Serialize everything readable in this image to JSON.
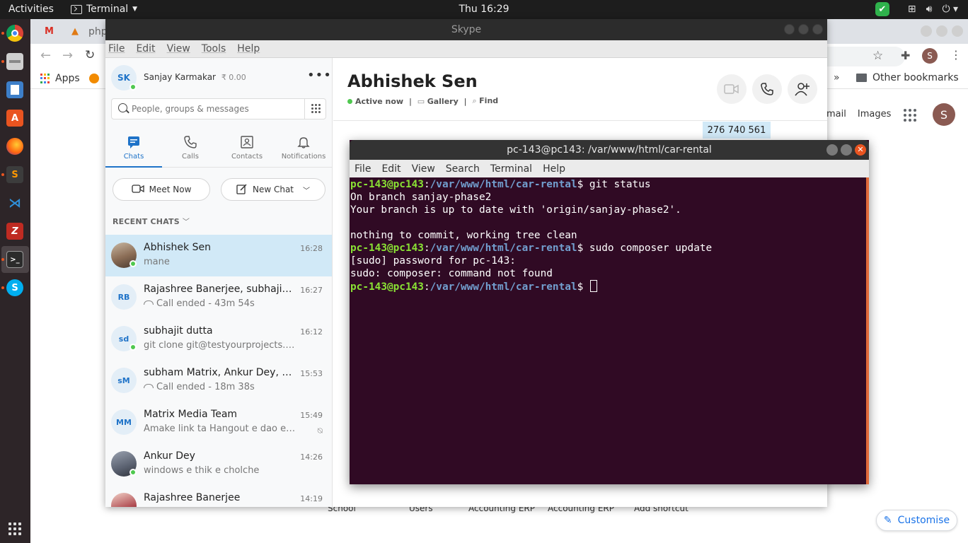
{
  "topbar": {
    "activities": "Activities",
    "app_name": "Terminal",
    "clock": "Thu 16:29"
  },
  "chrome": {
    "tab_partial": "php",
    "apps_label": "Apps",
    "bookmarks_chevron": "»",
    "other_bookmarks": "Other bookmarks",
    "profile_initial": "S",
    "google_links": [
      "mail",
      "Images"
    ],
    "avatar_initial": "S",
    "shortcuts": [
      "School",
      "Users",
      "Accounting ERP",
      "Accounting ERP",
      "Add shortcut"
    ],
    "customise": "Customise"
  },
  "skype": {
    "window_title": "Skype",
    "menu": [
      "File",
      "Edit",
      "View",
      "Tools",
      "Help"
    ],
    "profile": {
      "initials": "SK",
      "name": "Sanjay Karmakar",
      "credit": "₹ 0.00"
    },
    "search_placeholder": "People, groups & messages",
    "nav": [
      "Chats",
      "Calls",
      "Contacts",
      "Notifications"
    ],
    "meet_now": "Meet Now",
    "new_chat": "New Chat",
    "recent_header": "RECENT CHATS",
    "chats": [
      {
        "name": "Abhishek Sen",
        "time": "16:28",
        "message": "mane",
        "initials": ""
      },
      {
        "name": "Rajashree Banerjee, subhajit d...",
        "time": "16:27",
        "message": "Call ended - 43m 54s",
        "initials": "RB"
      },
      {
        "name": "subhajit dutta",
        "time": "16:12",
        "message": "git clone git@testyourprojects.b...",
        "initials": "sd"
      },
      {
        "name": "subham Matrix, Ankur Dey, 2 ...",
        "time": "15:53",
        "message": "Call ended - 18m 38s",
        "initials": "sM"
      },
      {
        "name": "Matrix Media Team",
        "time": "15:49",
        "message": "Amake link ta Hangout e dao ek...",
        "initials": "MM"
      },
      {
        "name": "Ankur Dey",
        "time": "14:26",
        "message": "windows e thik e cholche",
        "initials": ""
      },
      {
        "name": "Rajashree Banerjee",
        "time": "14:19",
        "message": "",
        "initials": ""
      }
    ],
    "conversation": {
      "title": "Abhishek Sen",
      "status": "Active now",
      "gallery": "Gallery",
      "find": "Find",
      "bubble": "276 740 561"
    }
  },
  "terminal": {
    "title": "pc-143@pc143: /var/www/html/car-rental",
    "menu": [
      "File",
      "Edit",
      "View",
      "Search",
      "Terminal",
      "Help"
    ],
    "user": "pc-143@pc143",
    "path": "/var/www/html/car-rental",
    "lines": [
      {
        "type": "prompt",
        "cmd": " git status"
      },
      {
        "type": "out",
        "text": "On branch sanjay-phase2"
      },
      {
        "type": "out",
        "text": "Your branch is up to date with 'origin/sanjay-phase2'."
      },
      {
        "type": "out",
        "text": ""
      },
      {
        "type": "out",
        "text": "nothing to commit, working tree clean"
      },
      {
        "type": "prompt",
        "cmd": " sudo composer update"
      },
      {
        "type": "out",
        "text": "[sudo] password for pc-143:"
      },
      {
        "type": "out",
        "text": "sudo: composer: command not found"
      },
      {
        "type": "prompt",
        "cmd": " "
      }
    ]
  },
  "colors": {
    "ubuntu_orange": "#e95420",
    "terminal_bg": "#300a24",
    "prompt_user": "#8ae234",
    "prompt_path": "#729fcf",
    "skype_blue": "#1f73c8",
    "presence_green": "#4fc84f"
  }
}
